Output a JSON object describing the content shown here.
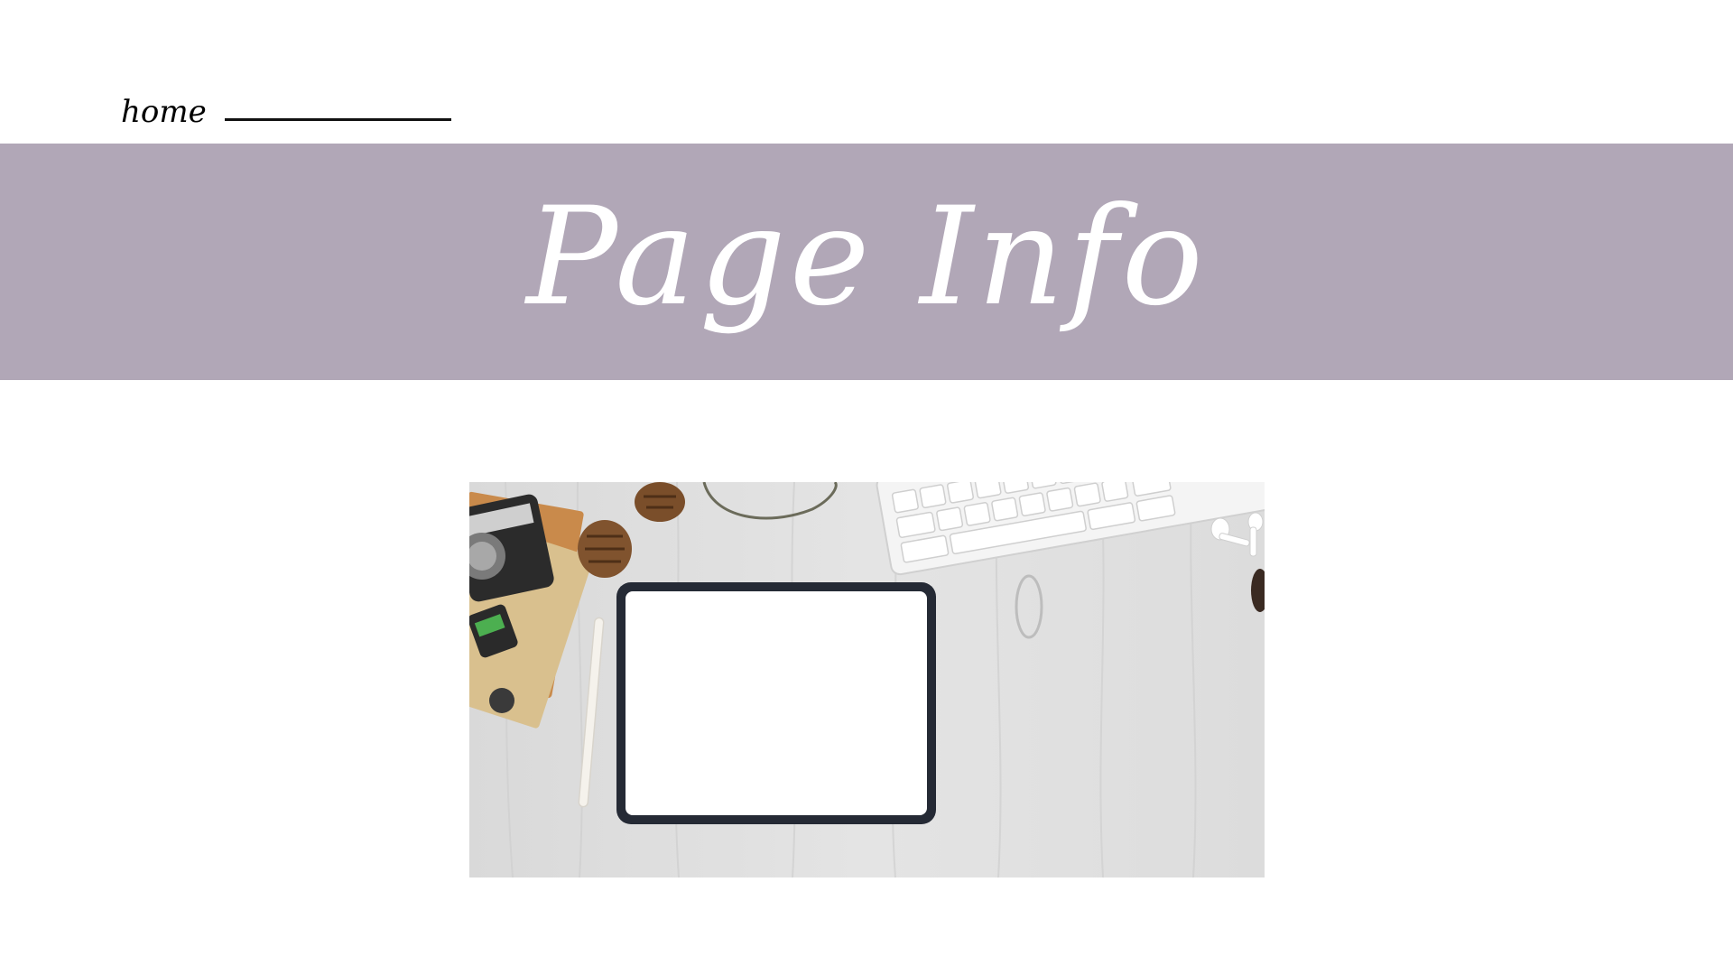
{
  "nav": {
    "home_label": "home"
  },
  "header": {
    "title": "Page Info"
  },
  "colors": {
    "band": "#b1a7b7",
    "background": "#ffffff",
    "title_text": "#ffffff",
    "nav_text": "#000000"
  },
  "photo": {
    "icons": [
      "camera-icon",
      "pinecone-icon",
      "keyboard-icon",
      "tablet-icon",
      "stylus-icon",
      "earbuds-icon",
      "film-roll-icon",
      "notebook-icon"
    ]
  }
}
